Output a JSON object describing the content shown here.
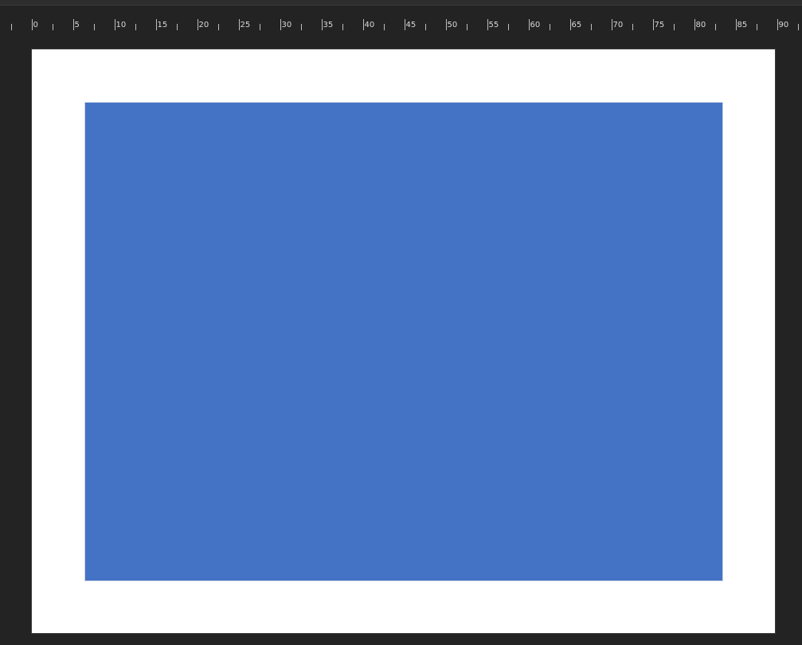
{
  "ruler": {
    "unit_labels": [
      "0",
      "5",
      "10",
      "15",
      "20",
      "25",
      "30",
      "35",
      "40",
      "45",
      "50",
      "55",
      "60",
      "65",
      "70",
      "75",
      "80",
      "85",
      "90"
    ]
  },
  "canvas": {
    "background_color": "#232323",
    "page_color": "#ffffff"
  },
  "shape": {
    "type": "rectangle",
    "fill_color": "#4472c4"
  }
}
